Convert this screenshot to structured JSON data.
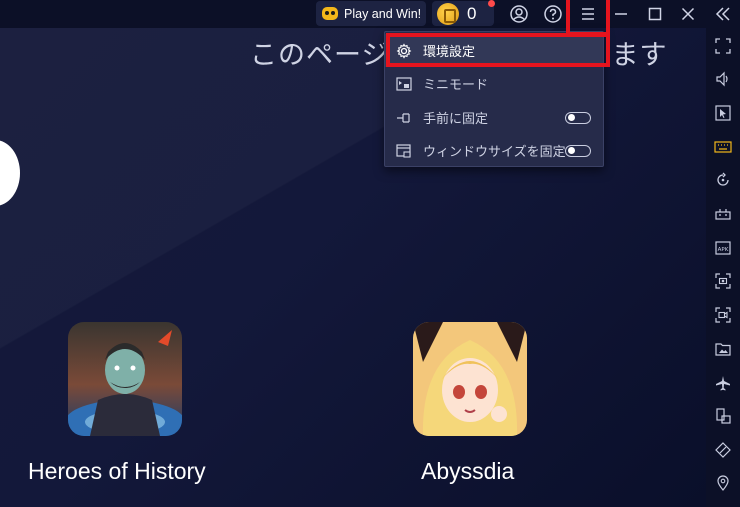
{
  "topbar": {
    "play_label": "Play and Win!",
    "coin_count": "0",
    "icons": [
      "account-icon",
      "help-icon",
      "hamburger-menu-icon",
      "minimize-icon",
      "maximize-icon",
      "close-icon",
      "collapse-sidebar-icon"
    ]
  },
  "main": {
    "heading_left": "このページ",
    "heading_right": "ます",
    "apps": [
      {
        "name": "Heroes of History"
      },
      {
        "name": "Abyssdia"
      }
    ]
  },
  "menu": {
    "items": [
      {
        "label": "環境設定",
        "icon": "gear-icon"
      },
      {
        "label": "ミニモード",
        "icon": "mini-mode-icon"
      },
      {
        "label": "手前に固定",
        "icon": "pin-icon",
        "toggle": false
      },
      {
        "label": "ウィンドウサイズを固定",
        "icon": "window-lock-icon",
        "toggle": false
      }
    ]
  },
  "sidebar": {
    "icons": [
      "fullscreen-icon",
      "volume-icon",
      "cursor-icon",
      "keyboard-icon",
      "rotate-icon",
      "gamepad-icon",
      "apk-install-icon",
      "screenshot-icon",
      "record-icon",
      "media-folder-icon",
      "airplane-mode-icon",
      "multi-instance-icon",
      "eco-mode-icon",
      "location-icon"
    ]
  },
  "colors": {
    "highlight": "#e5141e",
    "accent": "#f3b71a",
    "background": "#0d1230"
  }
}
